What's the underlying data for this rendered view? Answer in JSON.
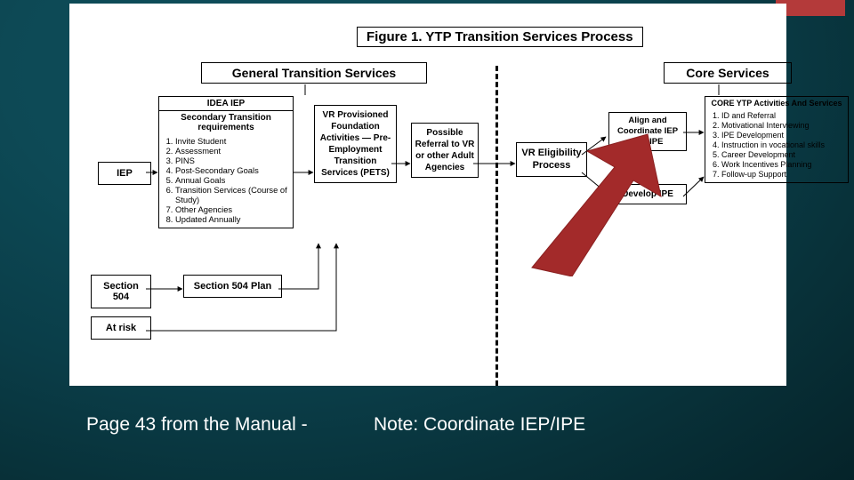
{
  "figure_title": "Figure 1. YTP Transition Services Process",
  "sections": {
    "gts": "General Transition Services",
    "core": "Core Services"
  },
  "stubs": {
    "iep": "IEP",
    "s504": "Section 504",
    "atrisk": "At risk"
  },
  "idea": {
    "header": "IDEA IEP",
    "sub": "Secondary Transition requirements",
    "items": [
      "Invite Student",
      "Assessment",
      "PINS",
      "Post-Secondary Goals",
      "Annual Goals",
      "Transition Services (Course of Study)",
      "Other Agencies",
      "Updated Annually"
    ]
  },
  "s504plan": "Section 504 Plan",
  "vrprov": "VR Provisioned Foundation Activities — Pre-Employment Transition Services (PETS)",
  "referral": "Possible Referral to VR or other Adult Agencies",
  "vrelig": "VR Eligibility Process",
  "align": "Align and Coordinate IEP and IPE",
  "devipe": "Develop IPE",
  "coreytp": {
    "header": "CORE YTP Activities And Services",
    "items": [
      "ID and Referral",
      "Motivational Interviewing",
      "IPE Development",
      "Instruction in vocational skills",
      "Career Development",
      "Work Incentives Planning",
      "Follow-up Support"
    ]
  },
  "caption_left": "Page 43 from the Manual -",
  "caption_right": "Note: Coordinate IEP/IPE"
}
